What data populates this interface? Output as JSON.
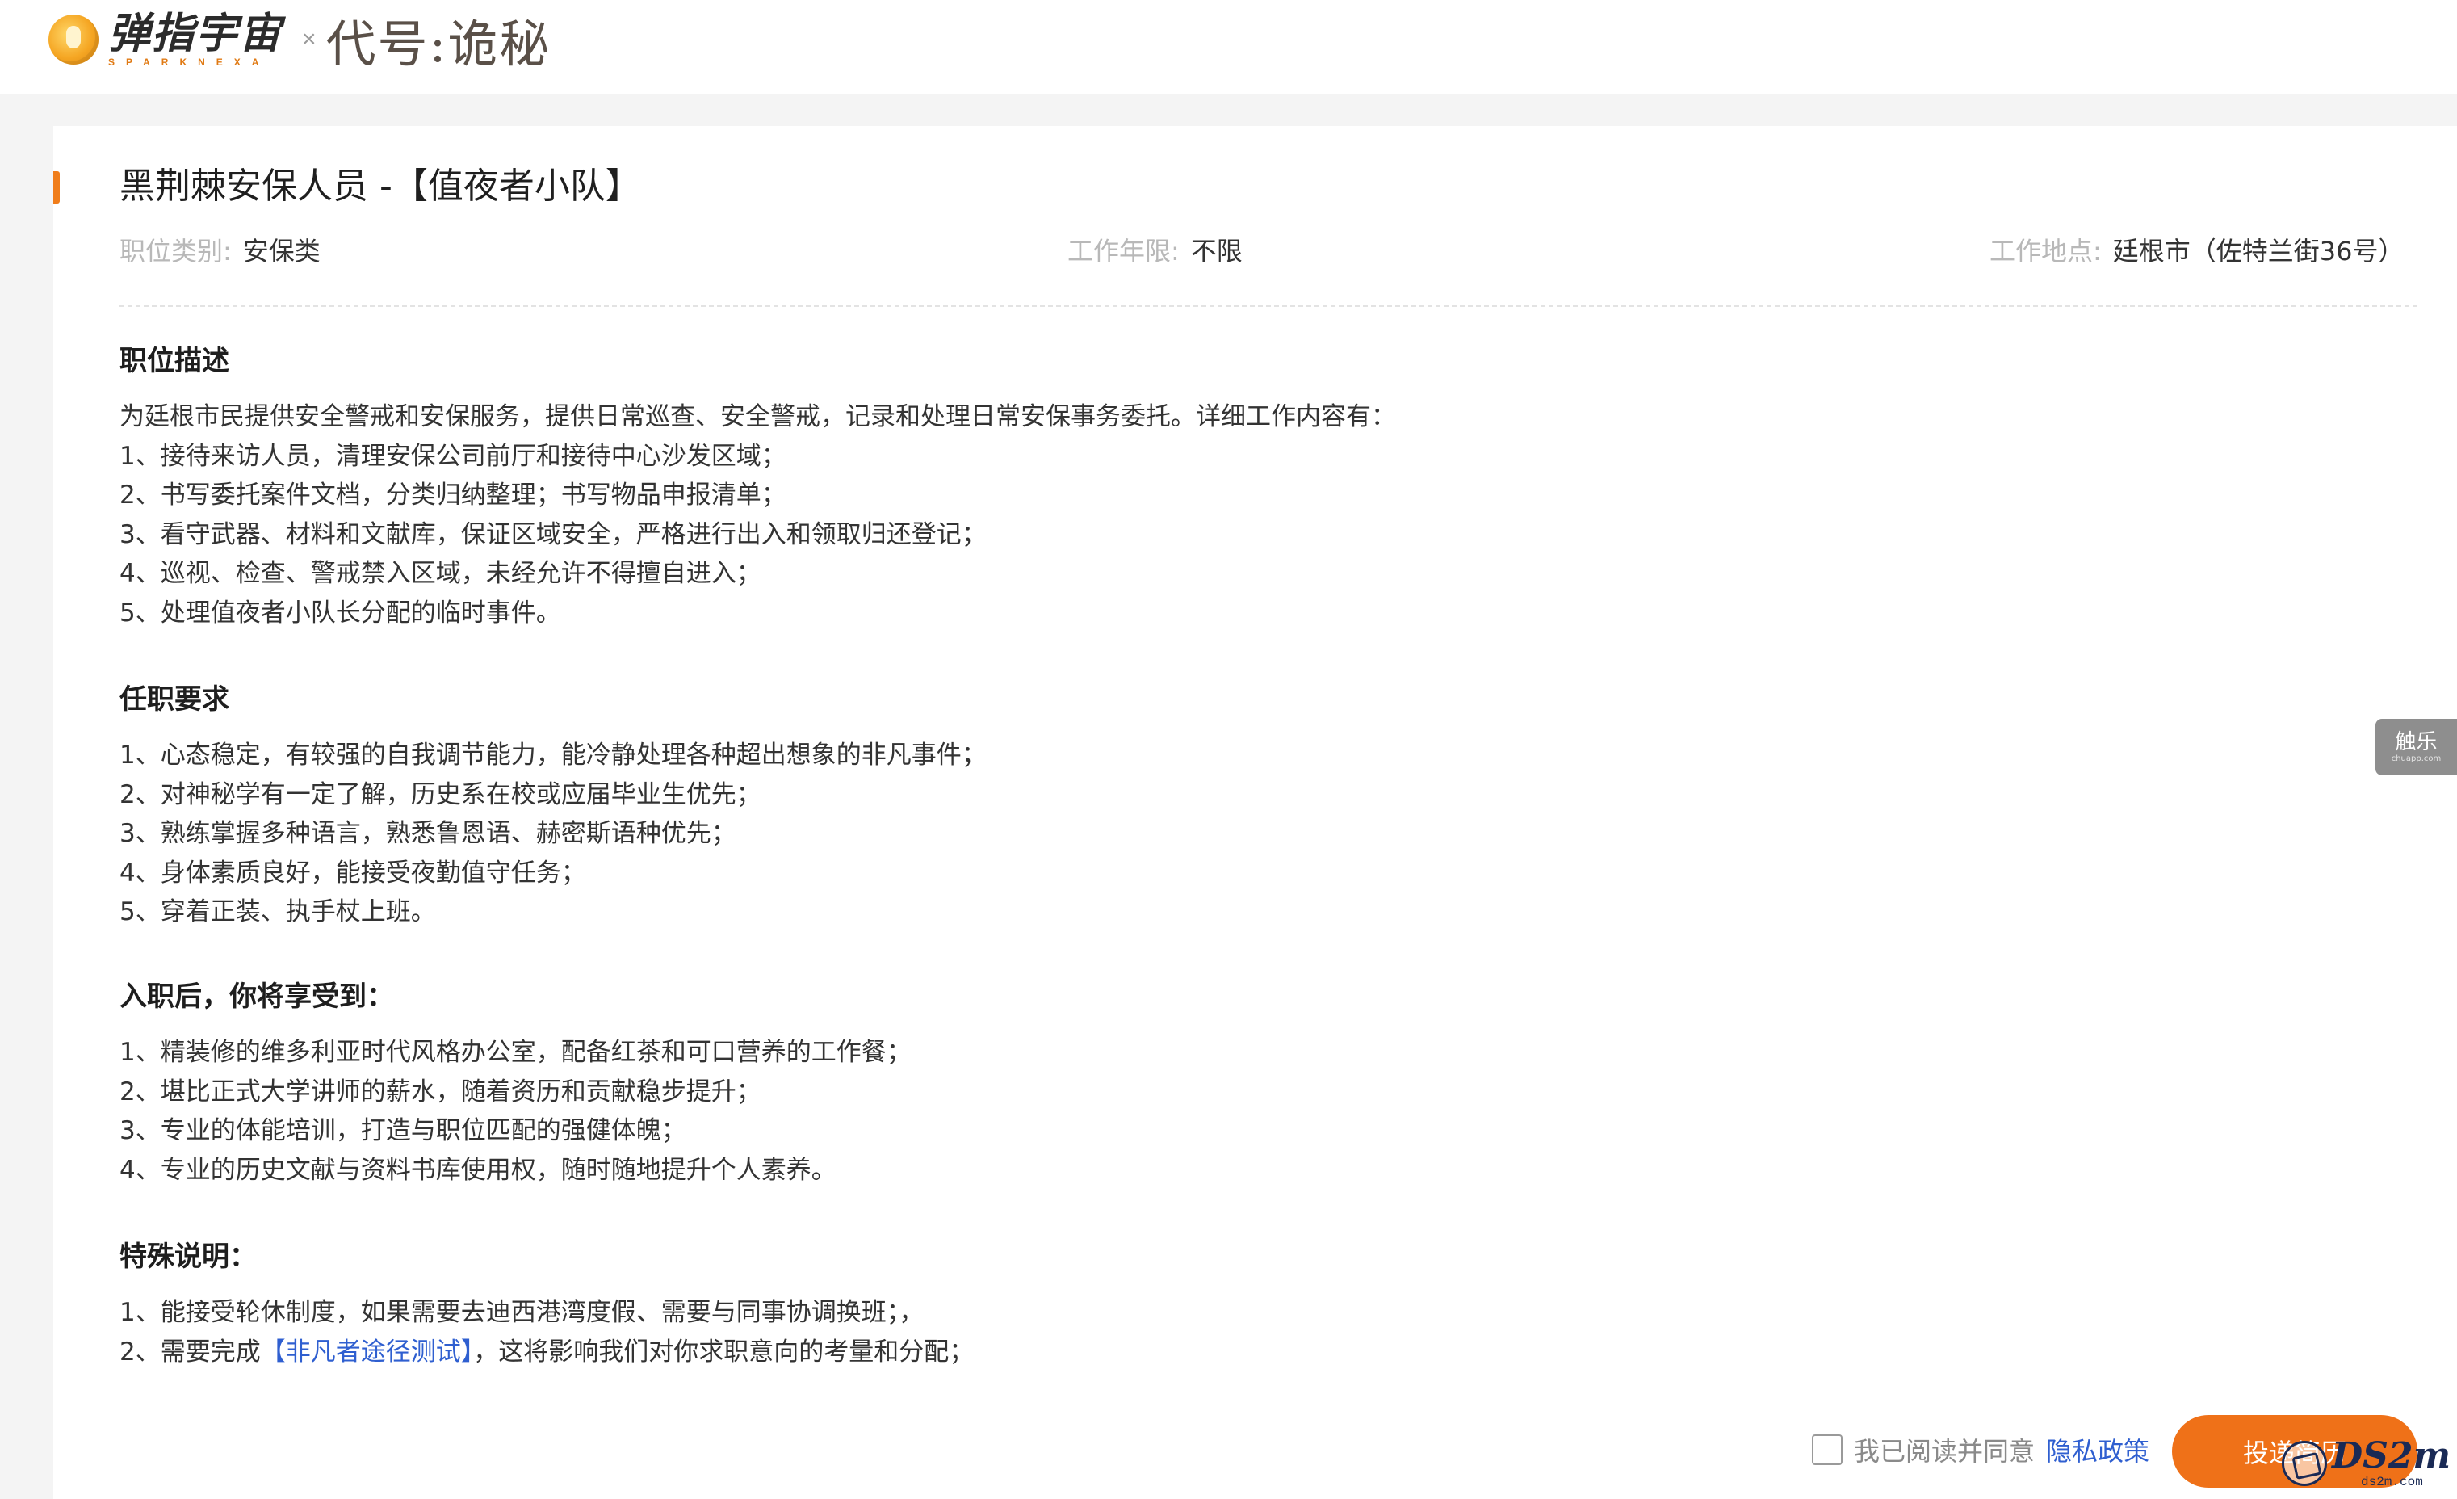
{
  "header": {
    "brand_cn": "弹指宇宙",
    "brand_en": "SPARKNEXA",
    "separator": "×",
    "game_title": "代号:诡秘"
  },
  "job": {
    "title": "黑荆棘安保人员 -【值夜者小队】",
    "meta": {
      "category_label": "职位类别:",
      "category_value": "安保类",
      "years_label": "工作年限:",
      "years_value": "不限",
      "location_label": "工作地点:",
      "location_value": "廷根市（佐特兰街36号）"
    }
  },
  "sections": {
    "description": {
      "heading": "职位描述",
      "lines": [
        "为廷根市民提供安全警戒和安保服务，提供日常巡查、安全警戒，记录和处理日常安保事务委托。详细工作内容有：",
        "1、接待来访人员，清理安保公司前厅和接待中心沙发区域；",
        "2、书写委托案件文档，分类归纳整理；书写物品申报清单；",
        "3、看守武器、材料和文献库，保证区域安全，严格进行出入和领取归还登记；",
        "4、巡视、检查、警戒禁入区域，未经允许不得擅自进入；",
        "5、处理值夜者小队长分配的临时事件。"
      ]
    },
    "requirements": {
      "heading": "任职要求",
      "lines": [
        "1、心态稳定，有较强的自我调节能力，能冷静处理各种超出想象的非凡事件；",
        "2、对神秘学有一定了解，历史系在校或应届毕业生优先；",
        "3、熟练掌握多种语言，熟悉鲁恩语、赫密斯语种优先；",
        "4、身体素质良好，能接受夜勤值守任务；",
        "5、穿着正装、执手杖上班。"
      ]
    },
    "benefits": {
      "heading": "入职后，你将享受到：",
      "lines": [
        "1、精装修的维多利亚时代风格办公室，配备红茶和可口营养的工作餐；",
        "2、堪比正式大学讲师的薪水，随着资历和贡献稳步提升；",
        "3、专业的体能培训，打造与职位匹配的强健体魄；",
        "4、专业的历史文献与资料书库使用权，随时随地提升个人素养。"
      ]
    },
    "notes": {
      "heading": "特殊说明：",
      "line1": "1、能接受轮休制度，如果需要去迪西港湾度假、需要与同事协调换班；，",
      "line2_prefix": "2、需要完成",
      "line2_link": "【非凡者途径测试】",
      "line2_suffix": "，这将影响我们对你求职意向的考量和分配；"
    }
  },
  "footer": {
    "agree_text": "我已阅读并同意",
    "privacy_link": "隐私政策",
    "apply_button": "投递简历",
    "checkbox_checked": false
  },
  "side_tab": {
    "label": "触乐",
    "sub": "chuapp.com"
  },
  "watermark": {
    "main": "DS2m",
    "sub": "ds2m.com"
  },
  "colors": {
    "accent": "#ef7118",
    "link": "#2f5fd0",
    "page_bg": "#f4f4f4"
  }
}
